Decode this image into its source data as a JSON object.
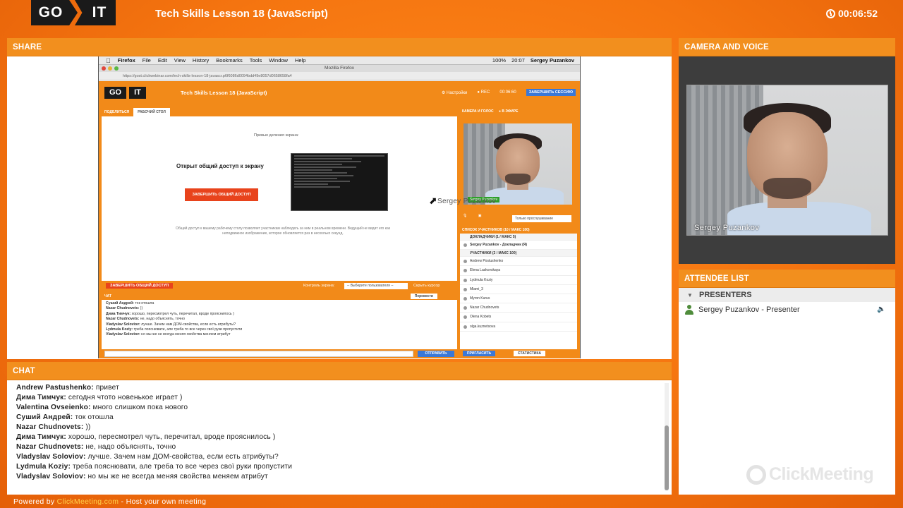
{
  "header": {
    "logo_left": "GO",
    "logo_right": "IT",
    "title": "Tech Skills Lesson 18 (JavaScript)",
    "timer": "00:06:52"
  },
  "share": {
    "label": "SHARE",
    "mac_menu": [
      "Firefox",
      "File",
      "Edit",
      "View",
      "History",
      "Bookmarks",
      "Tools",
      "Window",
      "Help"
    ],
    "mac_status": [
      "100%",
      "20:07",
      "Sergey Puzankov"
    ],
    "ff_title": "Mozilla Firefox",
    "ff_url": "https://gost.clickwebinar.com/tech-skills-lesson-18-javascr.p6f6086d0094bdd49e8057d0658658fa4",
    "inner": {
      "title": "Tech Skills Lesson 18 (JavaScript)",
      "settings": "Настройки",
      "rec": "REC",
      "time": "00:06:60",
      "end_session": "ЗАВЕРШИТЬ СЕССИЮ",
      "share_tab_1": "ПОДЕЛИТЬСЯ",
      "share_tab_2": "РАБОЧИЙ СТОЛ",
      "preview_label": "Превью деления экрана:",
      "open_access": "Открыт общий доступ к экрану",
      "stop_button": "ЗАВЕРШИТЬ ОБЩИЙ ДОСТУП",
      "description": "Общий доступ к вашему рабочему столу позволяет участникам наблюдать за ним в реальном времени. Ведущий не видит его как неподвижное изображение, которое обновляется раз в несколько секунд.",
      "stop_bar_button": "ЗАВЕРШИТЬ ОБЩИЙ ДОСТУП",
      "control_label": "Контроль экрана:",
      "control_select": "-- Выберите пользователя --",
      "hide_courses": "Скрыть курсор",
      "chat_label": "ЧАТ",
      "translate": "Перевести",
      "chat": [
        {
          "name": "Суший Андрей:",
          "text": " ток отошла"
        },
        {
          "name": "Nazar Chudnovets:",
          "text": " ))"
        },
        {
          "name": "Дима Тимчук:",
          "text": " хорошо, пересмотрел чуть, перечитал, вроде прояснилось )"
        },
        {
          "name": "Nazar Chudnovets:",
          "text": " не, надо объяснять, точно"
        },
        {
          "name": "Vladyslav Soloviov:",
          "text": " лучше. Зачем нам ДОМ-свойства, если есть атрибуты?"
        },
        {
          "name": "Lydmula Koziy:",
          "text": " треба пояснювати, але треба то все через свої руки пропустити"
        },
        {
          "name": "Vladyslav Soloviov:",
          "text": " но мы же не всегда меняя свойства меняем атрибут"
        }
      ],
      "send": "ОТПРАВИТЬ",
      "cam_label": "КАМЕРА И ГОЛОС",
      "cam_status": "В ЭФИРЕ",
      "cam_name": "Sergey Puzankov",
      "listen_only": "Только прослушивание",
      "participants_label": "СПИСОК УЧАСТНИКОВ (10 / МАКС 100)",
      "presenters_group": "ДОКЛАДЧИКИ (1 / МАКС 5)",
      "presenter": "Sergey Puzankov - Докладчик (Я)",
      "participants_group": "УЧАСТНИКИ (2 / МАКС 100)",
      "participants": [
        "Andrew Postushenko",
        "Elena Laskovskaya",
        "Lydmula Koziy",
        "Miami_3",
        "Myron Kurus",
        "Nazar Chudnovets",
        "Olena Kobets",
        "olga.kuznetsova"
      ],
      "invite": "ПРИГЛАСИТЬ",
      "stats": "СТАТИСТИКА"
    },
    "cursor_name": "Sergey Puzankov"
  },
  "camera": {
    "label": "CAMERA AND VOICE",
    "name": "Sergey Puzankov"
  },
  "attendees": {
    "label": "ATTENDEE LIST",
    "group": "PRESENTERS",
    "rows": [
      "Sergey Puzankov - Presenter"
    ],
    "watermark": "ClickMeeting"
  },
  "chat": {
    "label": "CHAT",
    "messages": [
      {
        "name": "Andrew Pastushenko:",
        "text": " привет"
      },
      {
        "name": "Дима Тимчук:",
        "text": " сегодня чтото новенькое играет )"
      },
      {
        "name": "Valentina Ovseienko:",
        "text": " много слишком пока нового"
      },
      {
        "name": "Суший Андрей:",
        "text": " ток отошла"
      },
      {
        "name": "Nazar Chudnovets:",
        "text": " ))"
      },
      {
        "name": "Дима Тимчук:",
        "text": " хорошо, пересмотрел чуть, перечитал, вроде прояснилось )"
      },
      {
        "name": "Nazar Chudnovets:",
        "text": " не, надо объяснять, точно"
      },
      {
        "name": "Vladyslav Soloviov:",
        "text": " лучше. Зачем нам ДОМ-свойства, если есть атрибуты?"
      },
      {
        "name": "Lydmula Koziy:",
        "text": " треба пояснювати, але треба то все через свої руки пропустити"
      },
      {
        "name": "Vladyslav Soloviov:",
        "text": " но мы же не всегда меняя свойства меняем атрибут"
      }
    ]
  },
  "footer": {
    "prefix": "Powered by ",
    "link": "ClickMeeting.com",
    "suffix": " - Host your own meeting"
  }
}
